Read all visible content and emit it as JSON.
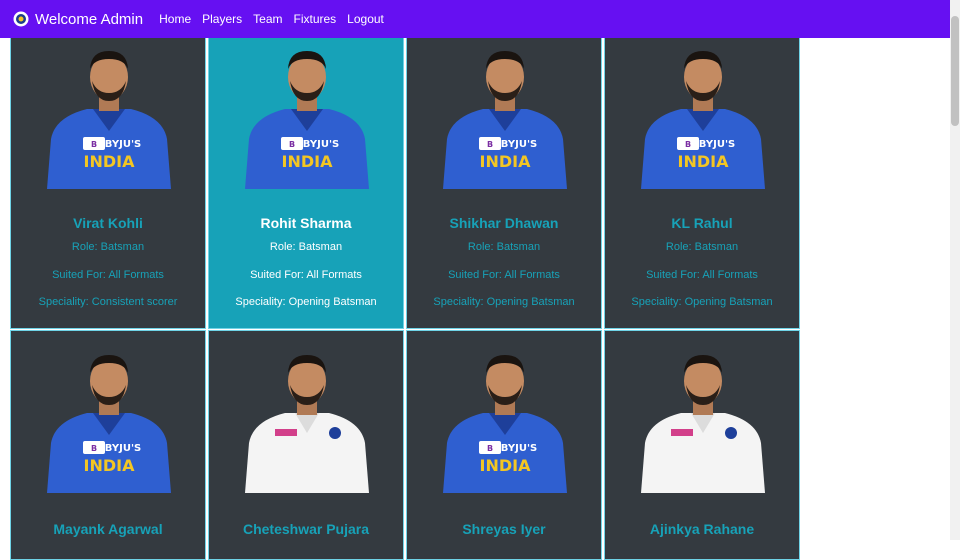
{
  "navbar": {
    "brand": "Welcome Admin",
    "links": [
      "Home",
      "Players",
      "Team",
      "Fixtures",
      "Logout"
    ]
  },
  "players": [
    {
      "name": "Virat Kohli",
      "role": "Role: Batsman",
      "suited": "Suited For: All Formats",
      "speciality": "Speciality: Consistent scorer",
      "kit": "blue"
    },
    {
      "name": "Rohit Sharma",
      "role": "Role: Batsman",
      "suited": "Suited For: All Formats",
      "speciality": "Speciality: Opening Batsman",
      "kit": "blue"
    },
    {
      "name": "Shikhar Dhawan",
      "role": "Role: Batsman",
      "suited": "Suited For: All Formats",
      "speciality": "Speciality: Opening Batsman",
      "kit": "blue"
    },
    {
      "name": "KL Rahul",
      "role": "Role: Batsman",
      "suited": "Suited For: All Formats",
      "speciality": "Speciality: Opening Batsman",
      "kit": "blue"
    },
    {
      "name": "Mayank Agarwal",
      "kit": "blue"
    },
    {
      "name": "Cheteshwar Pujara",
      "kit": "white"
    },
    {
      "name": "Shreyas Iyer",
      "kit": "blue"
    },
    {
      "name": "Ajinkya Rahane",
      "kit": "white"
    }
  ],
  "jersey": {
    "sponsor": "BYJU'S",
    "country": "INDIA"
  },
  "colors": {
    "navbar": "#6610f2",
    "card": "#343a40",
    "card_active": "#17a2b8",
    "text_accent": "#17a2b8"
  }
}
